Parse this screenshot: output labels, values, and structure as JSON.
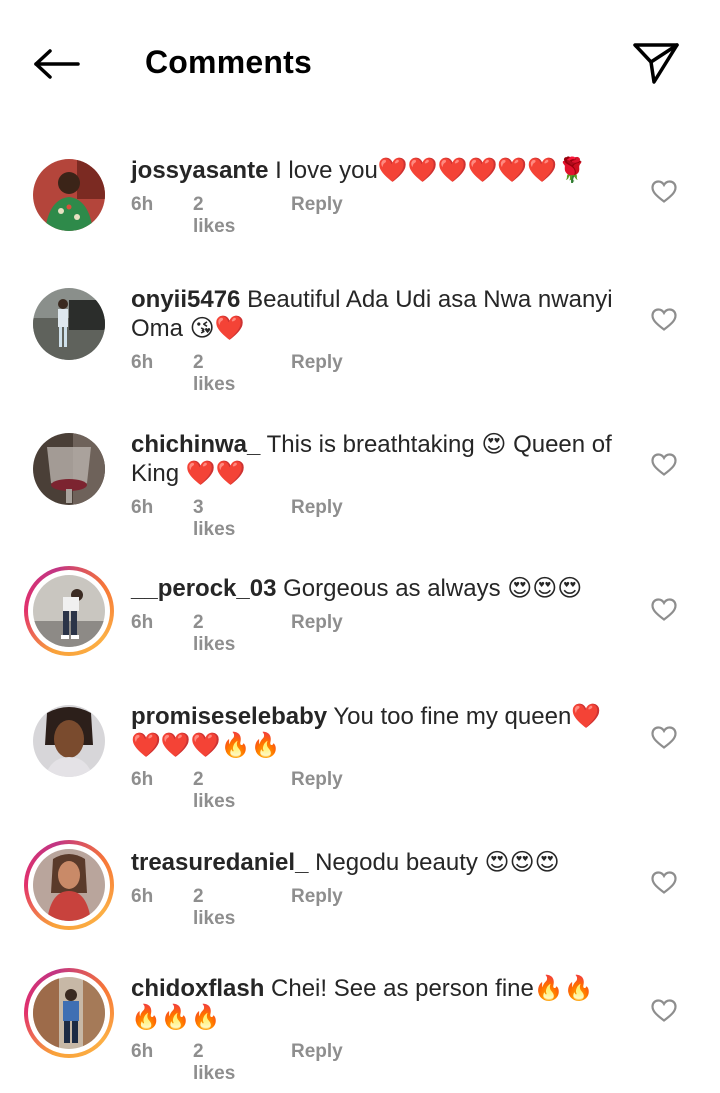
{
  "header": {
    "title": "Comments",
    "back_icon": "arrow-left-icon",
    "share_icon": "paper-plane-icon"
  },
  "comments": [
    {
      "username": "jossyasante",
      "text": "I love you❤️❤️❤️❤️❤️❤️🌹",
      "time": "6h",
      "likes": "2 likes",
      "reply": "Reply",
      "story_ring": false
    },
    {
      "username": "onyii5476",
      "text": "Beautiful Ada Udi asa Nwa nwanyi Oma 😘❤️",
      "time": "6h",
      "likes": "2 likes",
      "reply": "Reply",
      "story_ring": false
    },
    {
      "username": "chichinwa_",
      "text": "This is breathtaking 😍 Queen of King ❤️❤️",
      "time": "6h",
      "likes": "3 likes",
      "reply": "Reply",
      "story_ring": false
    },
    {
      "username": "__perock_03",
      "text": "Gorgeous as always 😍😍😍",
      "time": "6h",
      "likes": "2 likes",
      "reply": "Reply",
      "story_ring": true
    },
    {
      "username": "promiseselebaby",
      "text": "You too fine my queen❤️❤️❤️❤️🔥🔥",
      "time": "6h",
      "likes": "2 likes",
      "reply": "Reply",
      "story_ring": false
    },
    {
      "username": "treasuredaniel_",
      "text": "Negodu beauty 😍😍😍",
      "time": "6h",
      "likes": "2 likes",
      "reply": "Reply",
      "story_ring": true
    },
    {
      "username": "chidoxflash",
      "text": "Chei! See as person fine🔥🔥🔥🔥🔥",
      "time": "6h",
      "likes": "2 likes",
      "reply": "Reply",
      "story_ring": true
    }
  ],
  "colors": {
    "text": "#262626",
    "meta": "#8e8e8e",
    "story_ring_start": "#f9a23a",
    "story_ring_end": "#c13584"
  }
}
